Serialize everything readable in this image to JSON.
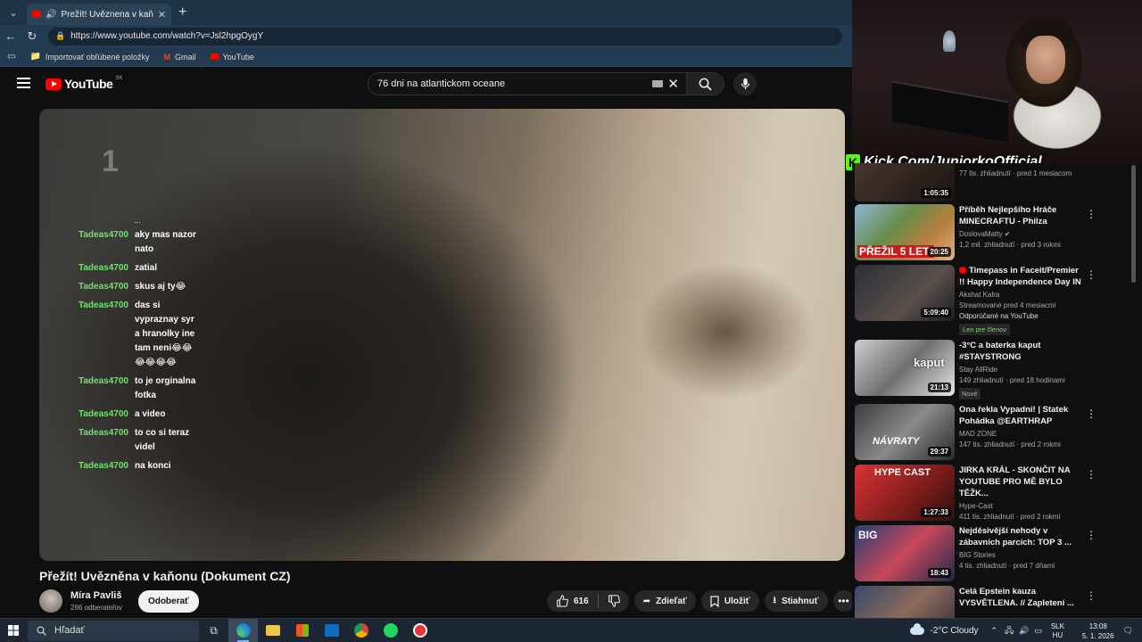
{
  "browser": {
    "tab_title": "Prežít! Uvěznena v kaňonu (D",
    "url": "https://www.youtube.com/watch?v=Jsl2hpgOygY",
    "bookmarks": [
      {
        "label": "Importovať obľúbené položky",
        "icon": "import-icon"
      },
      {
        "label": "Gmail",
        "icon": "gmail-icon"
      },
      {
        "label": "YouTube",
        "icon": "youtube-icon"
      }
    ]
  },
  "youtube": {
    "logo_text": "YouTube",
    "region": "SK",
    "search_query": "76 dni na atlantickom oceane"
  },
  "video": {
    "overlay_channel_number": "1",
    "title": "Přežít! Uvězněna v kaňonu (Dokument CZ)",
    "channel_name": "Míra Pavliš",
    "subscribers": "266 odberateľov",
    "subscribe_label": "Odoberať",
    "likes": "616",
    "share_label": "Zdieľať",
    "save_label": "Uložiť",
    "download_label": "Stiahnuť"
  },
  "chat": {
    "ellipsis": "...",
    "messages": [
      {
        "user": "Tadeas4700",
        "text": "aky mas nazor nato"
      },
      {
        "user": "Tadeas4700",
        "text": "zatial"
      },
      {
        "user": "Tadeas4700",
        "text": "skus aj ty😂"
      },
      {
        "user": "Tadeas4700",
        "text": "das si vypraznay syr a hranolky ine tam neni😂😂😂😂😂😂"
      },
      {
        "user": "Tadeas4700",
        "text": "to je orginalna fotka"
      },
      {
        "user": "Tadeas4700",
        "text": "a video"
      },
      {
        "user": "Tadeas4700",
        "text": "to co si teraz videl"
      },
      {
        "user": "Tadeas4700",
        "text": "na konci"
      }
    ]
  },
  "stream_overlay": {
    "kick_text": "Kick.Com/JuniorkoOfficial"
  },
  "recommendations": [
    {
      "title": "",
      "channel": "",
      "stats": "77 tis. zhliadnutí · pred 1 mesiacom",
      "duration": "1:05:35"
    },
    {
      "title": "Příběh Nejlepšího Hráče MINECRAFTU - Philza",
      "channel": "DoslovaMatty ✔",
      "stats": "1,2 mil. zhliadnutí · pred 3 rokmi",
      "duration": "20:25",
      "thumb_text": "PŘEŽIL 5 LET!"
    },
    {
      "title": "Timepass in Faceit/Premier !! Happy Independence Day IN",
      "channel": "Akshat Kalra",
      "stats": "Streamované pred 4 mesiacmi",
      "extra": "Odporúčané na YouTube",
      "member": "Len pre členov",
      "duration": "5:09:40"
    },
    {
      "title": "-3°C a baterka kaput #STAYSTRONG",
      "channel": "Stay AllRide",
      "stats": "149 zhliadnutí · pred 18 hodinami",
      "badge": "Nové",
      "duration": "21:13",
      "thumb_text": "kaput"
    },
    {
      "title": "Ona řekla Vypadni! | Statek Pohádka @EARTHRAP",
      "channel": "MAD ZONE",
      "stats": "147 tis. zhliadnutí · pred 2 rokmi",
      "duration": "29:37",
      "thumb_text": "NÁVRATY"
    },
    {
      "title": "JIRKA KRÁL - SKONČIT NA YOUTUBE PRO MĚ BYLO TĚŽK...",
      "channel": "Hype-Cast",
      "stats": "411 tis. zhliadnutí · pred 2 rokmi",
      "duration": "1:27:33",
      "thumb_text": "HYPE CAST"
    },
    {
      "title": "Nejděsivější nehody v zábavních parcích: TOP 3 ...",
      "channel": "BIG Stories",
      "stats": "4 tis. zhliadnutí · pred 7 dňami",
      "duration": "18:43",
      "thumb_text": "BIG"
    },
    {
      "title": "Celá Epstein kauza VYSVĚTLENA. // Zapletení ...",
      "channel": "",
      "stats": "",
      "duration": ""
    }
  ],
  "taskbar": {
    "search_placeholder": "Hľadať",
    "weather": "-2°C  Cloudy",
    "lang_top": "SLK",
    "lang_bottom": "HU",
    "time": "13:08",
    "date": "5. 1. 2026"
  },
  "colors": {
    "yt_red": "#ff0000",
    "chat_user": "#6ee36e",
    "kick_green": "#53fc18"
  }
}
